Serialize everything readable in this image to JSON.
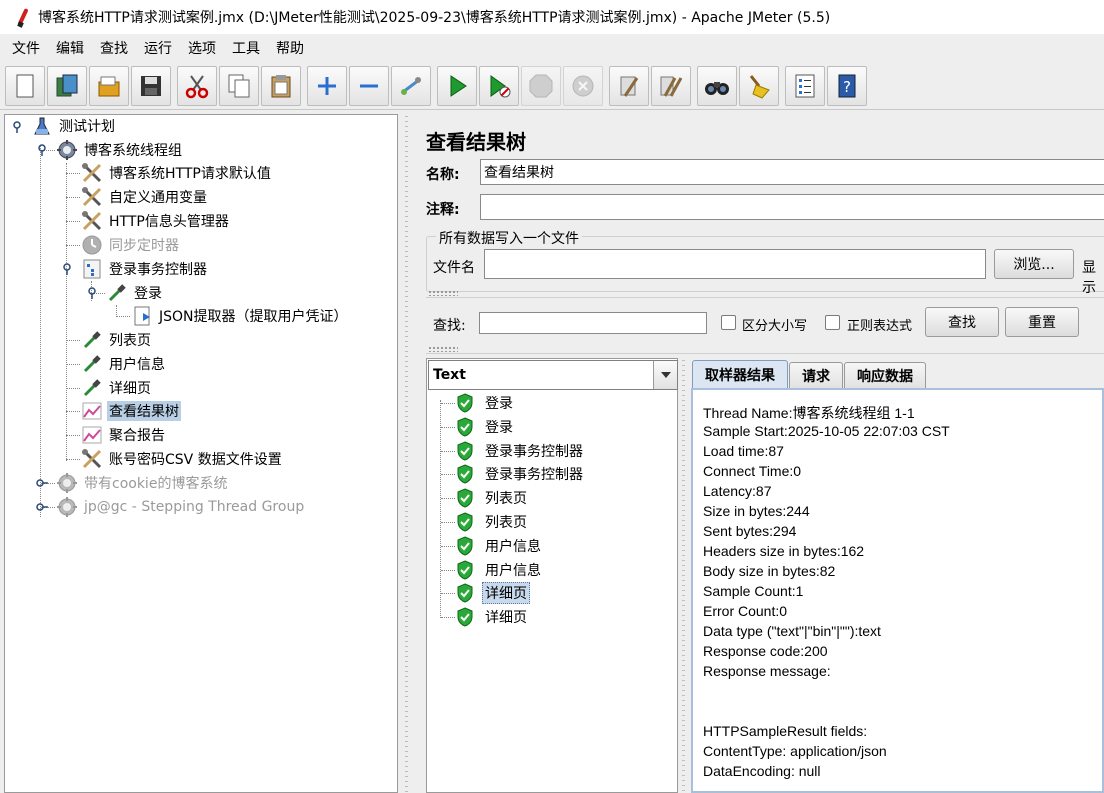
{
  "window": {
    "title": "博客系统HTTP请求测试案例.jmx (D:\\JMeter性能测试\\2025-09-23\\博客系统HTTP请求测试案例.jmx) - Apache JMeter (5.5)"
  },
  "menu": [
    "文件",
    "编辑",
    "查找",
    "运行",
    "选项",
    "工具",
    "帮助"
  ],
  "toolbar": {
    "icons": [
      "new-icon",
      "templates-icon",
      "open-icon",
      "save-icon",
      "cut-icon",
      "copy-icon",
      "paste-icon",
      "expand-icon",
      "collapse-icon",
      "toggle-icon",
      "start-icon",
      "start-no-pause-icon",
      "stop-icon",
      "shutdown-icon",
      "clear-icon",
      "clear-all-icon",
      "search-icon",
      "reset-search-icon",
      "function-helper-icon",
      "help-icon"
    ]
  },
  "tree": {
    "items": [
      {
        "label": "测试计划",
        "icon": "flask-icon"
      },
      {
        "label": "博客系统线程组",
        "icon": "gear-icon"
      },
      {
        "label": "博客系统HTTP请求默认值",
        "icon": "tools-icon"
      },
      {
        "label": "自定义通用变量",
        "icon": "tools-icon"
      },
      {
        "label": "HTTP信息头管理器",
        "icon": "tools-icon"
      },
      {
        "label": "同步定时器",
        "icon": "timer-icon"
      },
      {
        "label": "登录事务控制器",
        "icon": "controller-icon"
      },
      {
        "label": "登录",
        "icon": "pipette-icon"
      },
      {
        "label": "JSON提取器（提取用户凭证）",
        "icon": "extractor-icon"
      },
      {
        "label": "列表页",
        "icon": "pipette-icon"
      },
      {
        "label": "用户信息",
        "icon": "pipette-icon"
      },
      {
        "label": "详细页",
        "icon": "pipette-icon"
      },
      {
        "label": "查看结果树",
        "icon": "chart-icon"
      },
      {
        "label": "聚合报告",
        "icon": "chart-icon"
      },
      {
        "label": "账号密码CSV 数据文件设置",
        "icon": "tools-icon"
      },
      {
        "label": "带有cookie的博客系统",
        "icon": "gear-icon"
      },
      {
        "label": "jp@gc - Stepping Thread Group",
        "icon": "gear-icon"
      }
    ]
  },
  "panel": {
    "title": "查看结果树",
    "name_label": "名称:",
    "name_value": "查看结果树",
    "comment_label": "注释:",
    "comment_value": "",
    "file_group_title": "所有数据写入一个文件",
    "file_label": "文件名",
    "file_value": "",
    "browse_label": "浏览...",
    "display_label": "显示"
  },
  "search": {
    "label": "查找:",
    "value": "",
    "case_label": "区分大小写",
    "regex_label": "正则表达式",
    "find_button": "查找",
    "reset_button": "重置"
  },
  "results": {
    "renderer": "Text",
    "items": [
      "登录",
      "登录",
      "登录事务控制器",
      "登录事务控制器",
      "列表页",
      "列表页",
      "用户信息",
      "用户信息",
      "详细页",
      "详细页"
    ]
  },
  "tabs": [
    "取样器结果",
    "请求",
    "响应数据"
  ],
  "detail": {
    "lines": [
      "Thread Name:博客系统线程组 1-1",
      "Sample Start:2025-10-05 22:07:03 CST",
      "Load time:87",
      "Connect Time:0",
      "Latency:87",
      "Size in bytes:244",
      "Sent bytes:294",
      "Headers size in bytes:162",
      "Body size in bytes:82",
      "Sample Count:1",
      "Error Count:0",
      "Data type (\"text\"|\"bin\"|\"\"):text",
      "Response code:200",
      "Response message:",
      "",
      "",
      "HTTPSampleResult fields:",
      "ContentType: application/json",
      "DataEncoding: null"
    ]
  }
}
